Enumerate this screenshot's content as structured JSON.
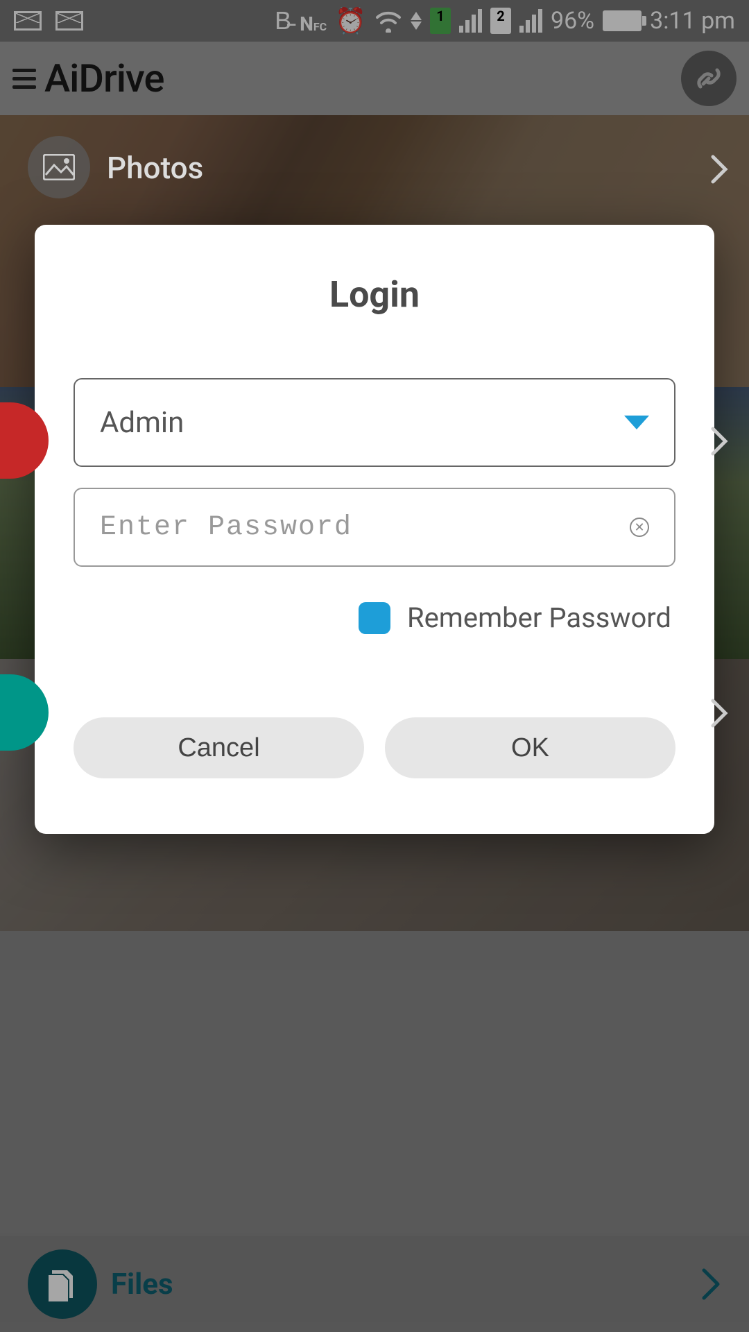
{
  "status": {
    "battery_pct": "96%",
    "time": "3:11 pm"
  },
  "header": {
    "title": "AiDrive"
  },
  "sections": {
    "photos_label": "Photos",
    "files_label": "Files"
  },
  "dialog": {
    "title": "Login",
    "user_value": "Admin",
    "password_placeholder": "Enter Password",
    "remember_label": "Remember Password",
    "cancel_label": "Cancel",
    "ok_label": "OK"
  }
}
